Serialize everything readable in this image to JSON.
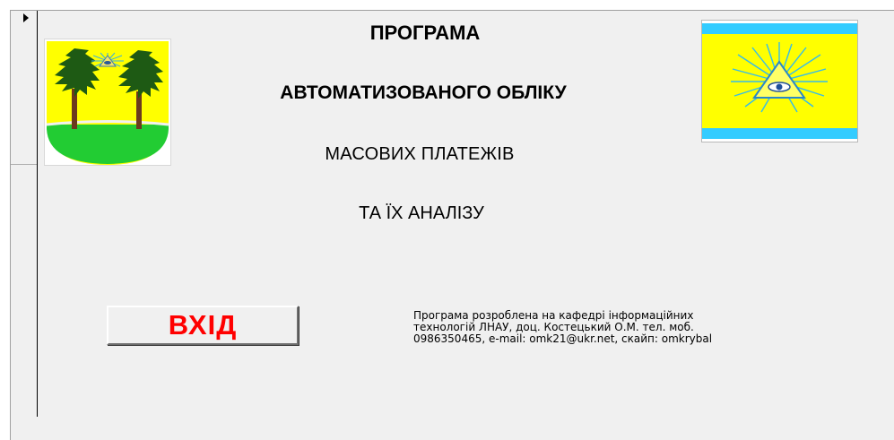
{
  "form": {
    "title_lines": [
      "ПРОГРАМА",
      "АВТОМАТИЗОВАНОГО ОБЛІКУ",
      "МАСОВИХ ПЛАТЕЖІВ",
      "ТА ЇХ АНАЛІЗУ"
    ],
    "enter_button_label": "ВХІД",
    "info_lines": [
      "Програма розроблена на кафедрі інформаційних",
      "технологій ЛНАУ, доц. Костецький О.М. тел. моб.",
      "0986350465, e-mail: omk21@ukr.net, скайп: omkrybal"
    ]
  },
  "colors": {
    "button_text": "#ff0000",
    "form_background": "#f0f0f0",
    "flag_yellow": "#ffff00",
    "flag_blue": "#33ccff",
    "emblem_green": "#22cc33"
  },
  "icons": {
    "record_selector": "triangle-right",
    "coat_of_arms": "coat-of-arms-trees-eye",
    "flag": "flag-eye-of-providence"
  }
}
